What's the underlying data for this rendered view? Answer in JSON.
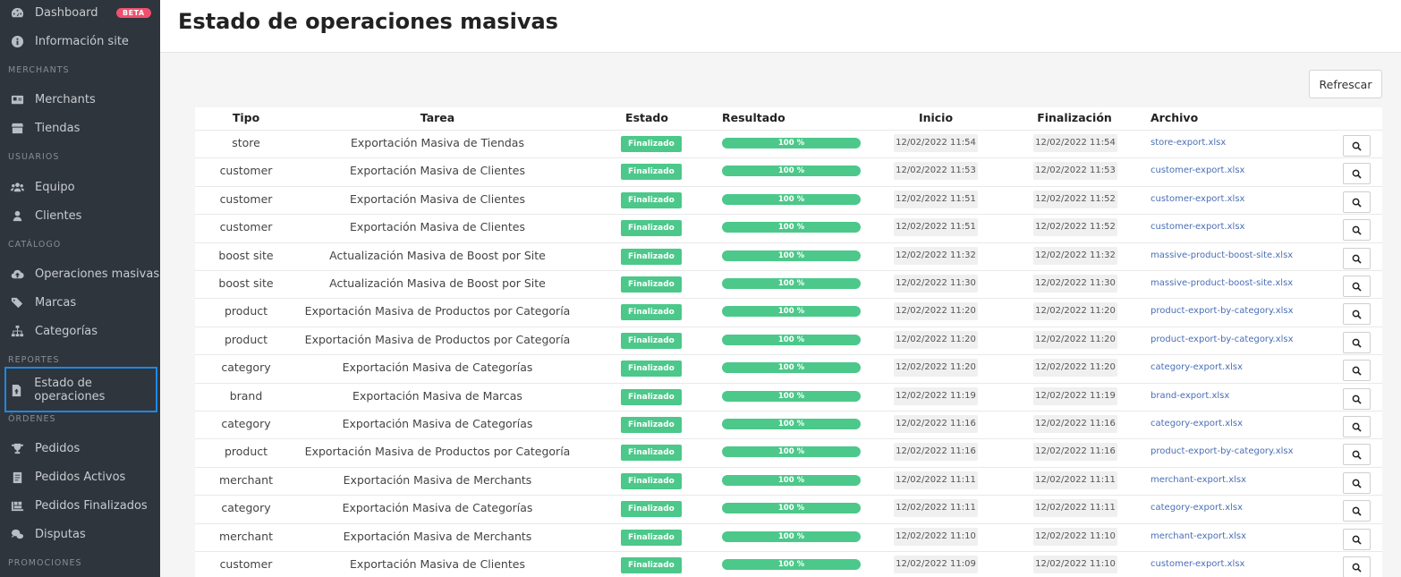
{
  "sidebar": {
    "dashboard": "Dashboard",
    "beta": "BETA",
    "info_site": "Información site",
    "sec_merchants": "MERCHANTS",
    "merchants": "Merchants",
    "tiendas": "Tiendas",
    "sec_usuarios": "USUARIOS",
    "equipo": "Equipo",
    "clientes": "Clientes",
    "sec_catalogo": "CATÁLOGO",
    "operaciones": "Operaciones masivas",
    "marcas": "Marcas",
    "categorias": "Categorías",
    "sec_reportes": "REPORTES",
    "estado": "Estado de operaciones",
    "sec_ordenes": "ÓRDENES",
    "pedidos": "Pedidos",
    "pedidos_activos": "Pedidos Activos",
    "pedidos_finalizados": "Pedidos Finalizados",
    "disputas": "Disputas",
    "sec_promociones": "PROMOCIONES"
  },
  "header": {
    "title": "Estado de operaciones masivas"
  },
  "toolbar": {
    "refresh_label": "Refrescar"
  },
  "table": {
    "columns": {
      "tipo": "Tipo",
      "tarea": "Tarea",
      "estado": "Estado",
      "resultado": "Resultado",
      "inicio": "Inicio",
      "fin": "Finalización",
      "archivo": "Archivo"
    },
    "rows": [
      {
        "tipo": "store",
        "tarea": "Exportación Masiva de Tiendas",
        "estado": "Finalizado",
        "progress": "100 %",
        "inicio": "12/02/2022 11:54",
        "fin": "12/02/2022 11:54",
        "archivo": "store-export.xlsx"
      },
      {
        "tipo": "customer",
        "tarea": "Exportación Masiva de Clientes",
        "estado": "Finalizado",
        "progress": "100 %",
        "inicio": "12/02/2022 11:53",
        "fin": "12/02/2022 11:53",
        "archivo": "customer-export.xlsx"
      },
      {
        "tipo": "customer",
        "tarea": "Exportación Masiva de Clientes",
        "estado": "Finalizado",
        "progress": "100 %",
        "inicio": "12/02/2022 11:51",
        "fin": "12/02/2022 11:52",
        "archivo": "customer-export.xlsx"
      },
      {
        "tipo": "customer",
        "tarea": "Exportación Masiva de Clientes",
        "estado": "Finalizado",
        "progress": "100 %",
        "inicio": "12/02/2022 11:51",
        "fin": "12/02/2022 11:52",
        "archivo": "customer-export.xlsx"
      },
      {
        "tipo": "boost site",
        "tarea": "Actualización Masiva de Boost por Site",
        "estado": "Finalizado",
        "progress": "100 %",
        "inicio": "12/02/2022 11:32",
        "fin": "12/02/2022 11:32",
        "archivo": "massive-product-boost-site.xlsx"
      },
      {
        "tipo": "boost site",
        "tarea": "Actualización Masiva de Boost por Site",
        "estado": "Finalizado",
        "progress": "100 %",
        "inicio": "12/02/2022 11:30",
        "fin": "12/02/2022 11:30",
        "archivo": "massive-product-boost-site.xlsx"
      },
      {
        "tipo": "product",
        "tarea": "Exportación Masiva de Productos por Categoría",
        "estado": "Finalizado",
        "progress": "100 %",
        "inicio": "12/02/2022 11:20",
        "fin": "12/02/2022 11:20",
        "archivo": "product-export-by-category.xlsx"
      },
      {
        "tipo": "product",
        "tarea": "Exportación Masiva de Productos por Categoría",
        "estado": "Finalizado",
        "progress": "100 %",
        "inicio": "12/02/2022 11:20",
        "fin": "12/02/2022 11:20",
        "archivo": "product-export-by-category.xlsx"
      },
      {
        "tipo": "category",
        "tarea": "Exportación Masiva de Categorías",
        "estado": "Finalizado",
        "progress": "100 %",
        "inicio": "12/02/2022 11:20",
        "fin": "12/02/2022 11:20",
        "archivo": "category-export.xlsx"
      },
      {
        "tipo": "brand",
        "tarea": "Exportación Masiva de Marcas",
        "estado": "Finalizado",
        "progress": "100 %",
        "inicio": "12/02/2022 11:19",
        "fin": "12/02/2022 11:19",
        "archivo": "brand-export.xlsx"
      },
      {
        "tipo": "category",
        "tarea": "Exportación Masiva de Categorías",
        "estado": "Finalizado",
        "progress": "100 %",
        "inicio": "12/02/2022 11:16",
        "fin": "12/02/2022 11:16",
        "archivo": "category-export.xlsx"
      },
      {
        "tipo": "product",
        "tarea": "Exportación Masiva de Productos por Categoría",
        "estado": "Finalizado",
        "progress": "100 %",
        "inicio": "12/02/2022 11:16",
        "fin": "12/02/2022 11:16",
        "archivo": "product-export-by-category.xlsx"
      },
      {
        "tipo": "merchant",
        "tarea": "Exportación Masiva de Merchants",
        "estado": "Finalizado",
        "progress": "100 %",
        "inicio": "12/02/2022 11:11",
        "fin": "12/02/2022 11:11",
        "archivo": "merchant-export.xlsx"
      },
      {
        "tipo": "category",
        "tarea": "Exportación Masiva de Categorías",
        "estado": "Finalizado",
        "progress": "100 %",
        "inicio": "12/02/2022 11:11",
        "fin": "12/02/2022 11:11",
        "archivo": "category-export.xlsx"
      },
      {
        "tipo": "merchant",
        "tarea": "Exportación Masiva de Merchants",
        "estado": "Finalizado",
        "progress": "100 %",
        "inicio": "12/02/2022 11:10",
        "fin": "12/02/2022 11:10",
        "archivo": "merchant-export.xlsx"
      },
      {
        "tipo": "customer",
        "tarea": "Exportación Masiva de Clientes",
        "estado": "Finalizado",
        "progress": "100 %",
        "inicio": "12/02/2022 11:09",
        "fin": "12/02/2022 11:10",
        "archivo": "customer-export.xlsx"
      }
    ]
  }
}
